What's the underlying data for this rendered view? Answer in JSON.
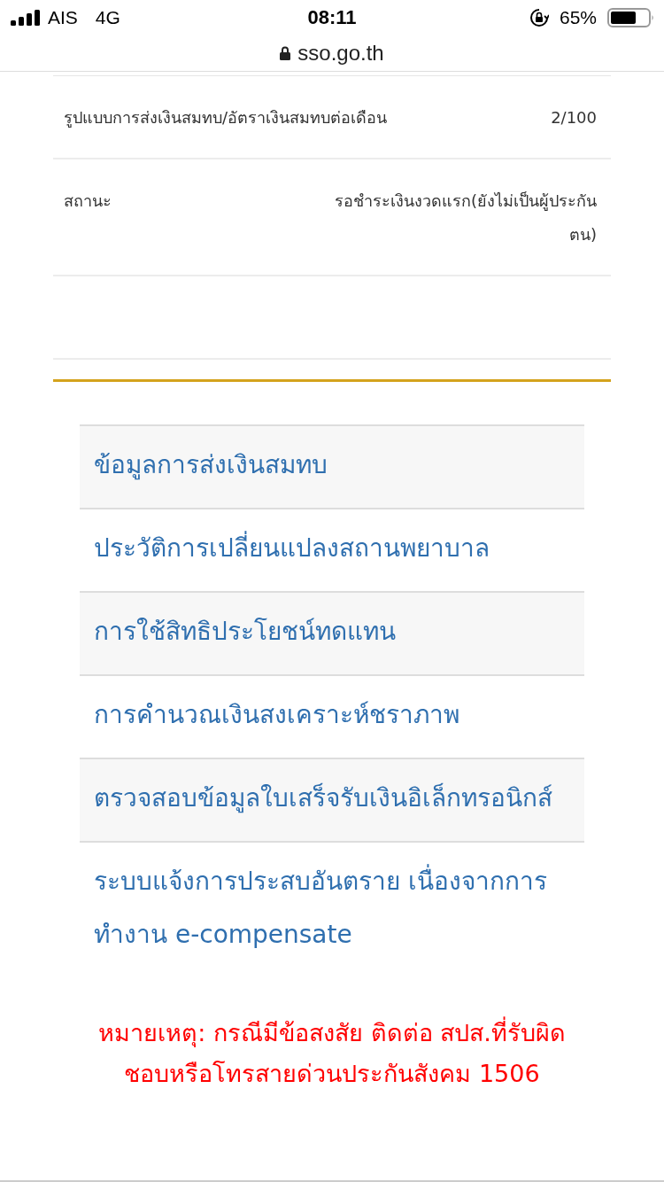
{
  "status_bar": {
    "carrier": "AIS",
    "network": "4G",
    "time": "08:11",
    "battery": "65%"
  },
  "address_bar": {
    "url": "sso.go.th"
  },
  "details": [
    {
      "label": "รูปแบบการส่งเงินสมทบ/อัตราเงินสมทบต่อเดือน",
      "value": "2/100"
    },
    {
      "label": "สถานะ",
      "value": "รอชำระเงินงวดแรก(ยังไม่เป็นผู้ประกันตน)"
    }
  ],
  "menu": [
    {
      "label": "ข้อมูลการส่งเงินสมทบ"
    },
    {
      "label": "ประวัติการเปลี่ยนแปลงสถานพยาบาล"
    },
    {
      "label": "การใช้สิทธิประโยชน์ทดแทน"
    },
    {
      "label": "การคำนวณเงินสงเคราะห์ชราภาพ"
    },
    {
      "label": "ตรวจสอบข้อมูลใบเสร็จรับเงินอิเล็กทรอนิกส์"
    },
    {
      "label": "ระบบแจ้งการประสบอันตราย เนื่องจากการทำงาน e-compensate"
    }
  ],
  "note": "หมายเหตุ: กรณีมีข้อสงสัย ติดต่อ สปส.ที่รับผิดชอบหรือโทรสายด่วนประกันสังคม 1506"
}
